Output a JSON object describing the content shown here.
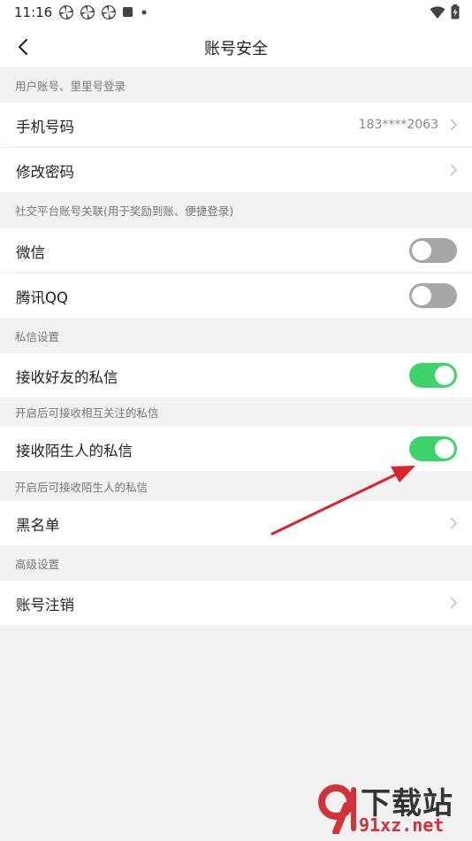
{
  "status_bar": {
    "time": "11:16",
    "icons": [
      "pinwheel-icon",
      "pinwheel-icon",
      "pinwheel-icon",
      "square-icon",
      "dot-icon"
    ],
    "right_icons": [
      "wifi-icon",
      "battery-charging-icon"
    ]
  },
  "nav": {
    "title": "账号安全",
    "back_icon": "chevron-left-icon"
  },
  "sections": {
    "account_login": "用户账号、里里号登录",
    "social": "社交平台账号关联(用于奖励到账、便捷登录)",
    "private_msg": "私信设置",
    "friend_msg_hint": "开启后可接收相互关注的私信",
    "stranger_msg_hint": "开启后可接收陌生人的私信",
    "advanced": "高级设置"
  },
  "rows": {
    "phone": {
      "label": "手机号码",
      "value": "183****2063"
    },
    "password": {
      "label": "修改密码"
    },
    "wechat": {
      "label": "微信",
      "toggle": "off"
    },
    "qq": {
      "label": "腾讯QQ",
      "toggle": "off"
    },
    "friend_msg": {
      "label": "接收好友的私信",
      "toggle": "on"
    },
    "stranger_msg": {
      "label": "接收陌生人的私信",
      "toggle": "on"
    },
    "blacklist": {
      "label": "黑名单"
    },
    "deactivate": {
      "label": "账号注销"
    }
  },
  "watermark": {
    "brand": "下载站",
    "url": "91xz.net"
  },
  "colors": {
    "toggle_on": "#3ed36a",
    "toggle_off": "#a6a6a6",
    "annotation_arrow": "#d9252b",
    "background": "#f2f2f2"
  }
}
